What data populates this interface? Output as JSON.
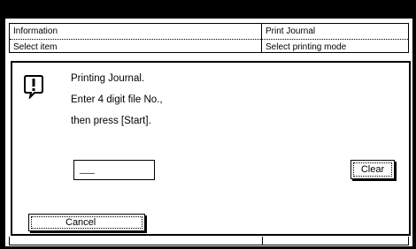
{
  "background": {
    "left_panel": {
      "title": "Information",
      "subtitle": "Select item"
    },
    "right_panel": {
      "title": "Print Journal",
      "subtitle": "Select printing mode"
    }
  },
  "dialog": {
    "icon": "exclamation-icon",
    "message_lines": [
      "Printing Journal.",
      "Enter 4 digit file No.,",
      "then press [Start]."
    ],
    "file_number_value": "__",
    "clear_label": "Clear",
    "cancel_label": "Cancel"
  }
}
